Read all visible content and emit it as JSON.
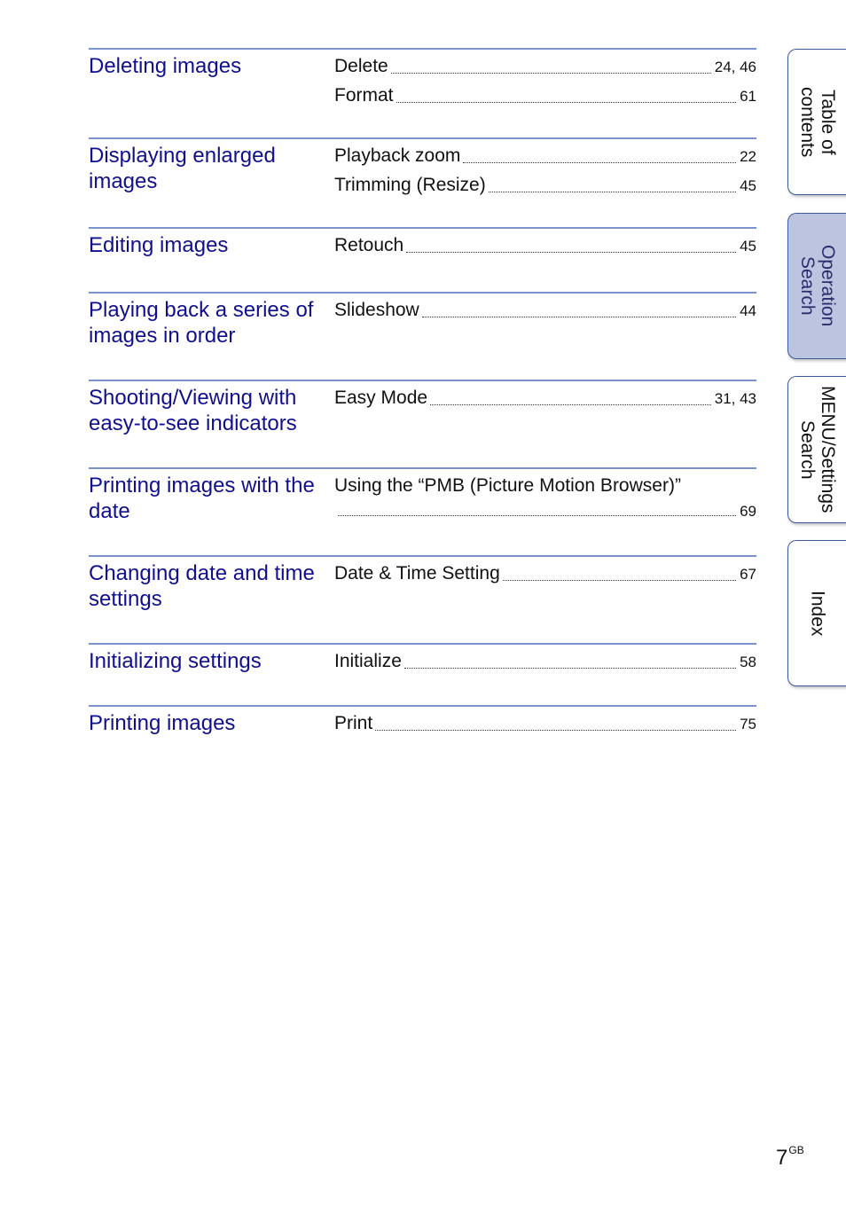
{
  "sections": [
    {
      "topic": "Deleting images",
      "entries": [
        {
          "label": "Delete",
          "pages": "24, 46"
        },
        {
          "label": "Format",
          "pages": "61"
        }
      ]
    },
    {
      "topic": "Displaying enlarged images",
      "entries": [
        {
          "label": "Playback zoom",
          "pages": "22"
        },
        {
          "label": "Trimming (Resize)",
          "pages": "45"
        }
      ]
    },
    {
      "topic": "Editing images",
      "entries": [
        {
          "label": "Retouch",
          "pages": "45"
        }
      ]
    },
    {
      "topic": "Playing back a series of images in order",
      "entries": [
        {
          "label": "Slideshow",
          "pages": "44"
        }
      ]
    },
    {
      "topic": "Shooting/Viewing with easy-to-see indicators",
      "entries": [
        {
          "label": "Easy Mode",
          "pages": "31, 43"
        }
      ]
    },
    {
      "topic": "Printing images with the date",
      "entries": [
        {
          "label": "Using the “PMB (Picture Motion Browser)”",
          "pages": "69"
        }
      ]
    },
    {
      "topic": "Changing date and time settings",
      "entries": [
        {
          "label": "Date & Time Setting",
          "pages": "67"
        }
      ]
    },
    {
      "topic": "Initializing settings",
      "entries": [
        {
          "label": "Initialize",
          "pages": "58"
        }
      ]
    },
    {
      "topic": "Printing images",
      "entries": [
        {
          "label": "Print",
          "pages": "75"
        }
      ]
    }
  ],
  "side_tabs": [
    {
      "label": "Table of\ncontents",
      "active": false
    },
    {
      "label": "Operation\nSearch",
      "active": true
    },
    {
      "label": "MENU/Settings\nSearch",
      "active": false
    },
    {
      "label": "Index",
      "active": false
    }
  ],
  "page": {
    "number": "7",
    "suffix": "GB"
  },
  "colors": {
    "topic_text": "#10108f",
    "rule": "#7a93cf",
    "active_tab": "#bcc4e0",
    "tab_border": "#3b5a9a"
  }
}
